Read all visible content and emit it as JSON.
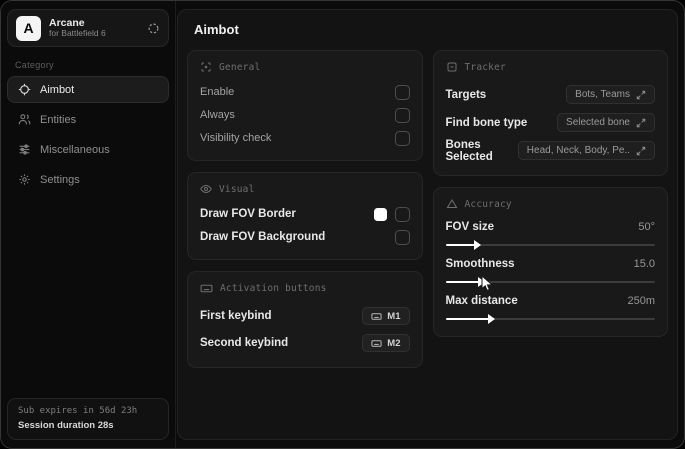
{
  "sidebar": {
    "logo_letter": "A",
    "app_name": "Arcane",
    "app_subtitle": "for Battlefield 6",
    "category_label": "Category",
    "items": [
      {
        "label": "Aimbot",
        "icon": "crosshair-icon",
        "selected": true
      },
      {
        "label": "Entities",
        "icon": "users-icon",
        "selected": false
      },
      {
        "label": "Miscellaneous",
        "icon": "sliders-icon",
        "selected": false
      },
      {
        "label": "Settings",
        "icon": "gear-icon",
        "selected": false
      }
    ],
    "subscription": {
      "expires_line": "Sub expires in 56d 23h",
      "session_line": "Session duration 28s"
    }
  },
  "main": {
    "title": "Aimbot",
    "general": {
      "title": "General",
      "rows": [
        {
          "label": "Enable",
          "checked": false
        },
        {
          "label": "Always",
          "checked": false
        },
        {
          "label": "Visibility check",
          "checked": false
        }
      ]
    },
    "visual": {
      "title": "Visual",
      "rows": [
        {
          "label": "Draw FOV Border",
          "swatch_color": "#ffffff",
          "checked": false
        },
        {
          "label": "Draw FOV Background",
          "checked": false
        }
      ]
    },
    "activation": {
      "title": "Activation buttons",
      "rows": [
        {
          "label": "First keybind",
          "key": "M1"
        },
        {
          "label": "Second keybind",
          "key": "M2"
        }
      ]
    },
    "tracker": {
      "title": "Tracker",
      "rows": [
        {
          "label": "Targets",
          "value": "Bots, Teams"
        },
        {
          "label": "Find bone type",
          "value": "Selected bone"
        },
        {
          "label": "Bones Selected",
          "value": "Head, Neck, Body, Pe.."
        }
      ]
    },
    "accuracy": {
      "title": "Accuracy",
      "sliders": [
        {
          "label": "FOV size",
          "value": "50°",
          "percent": 14
        },
        {
          "label": "Smoothness",
          "value": "15.0",
          "percent": 16
        },
        {
          "label": "Max distance",
          "value": "250m",
          "percent": 21
        }
      ]
    }
  },
  "colors": {
    "page_bg": "#0b0b0b",
    "panel_bg": "#131313",
    "card_bg": "#191919",
    "fov_border_swatch": "#ffffff",
    "slider_fill": "#ffffff"
  }
}
